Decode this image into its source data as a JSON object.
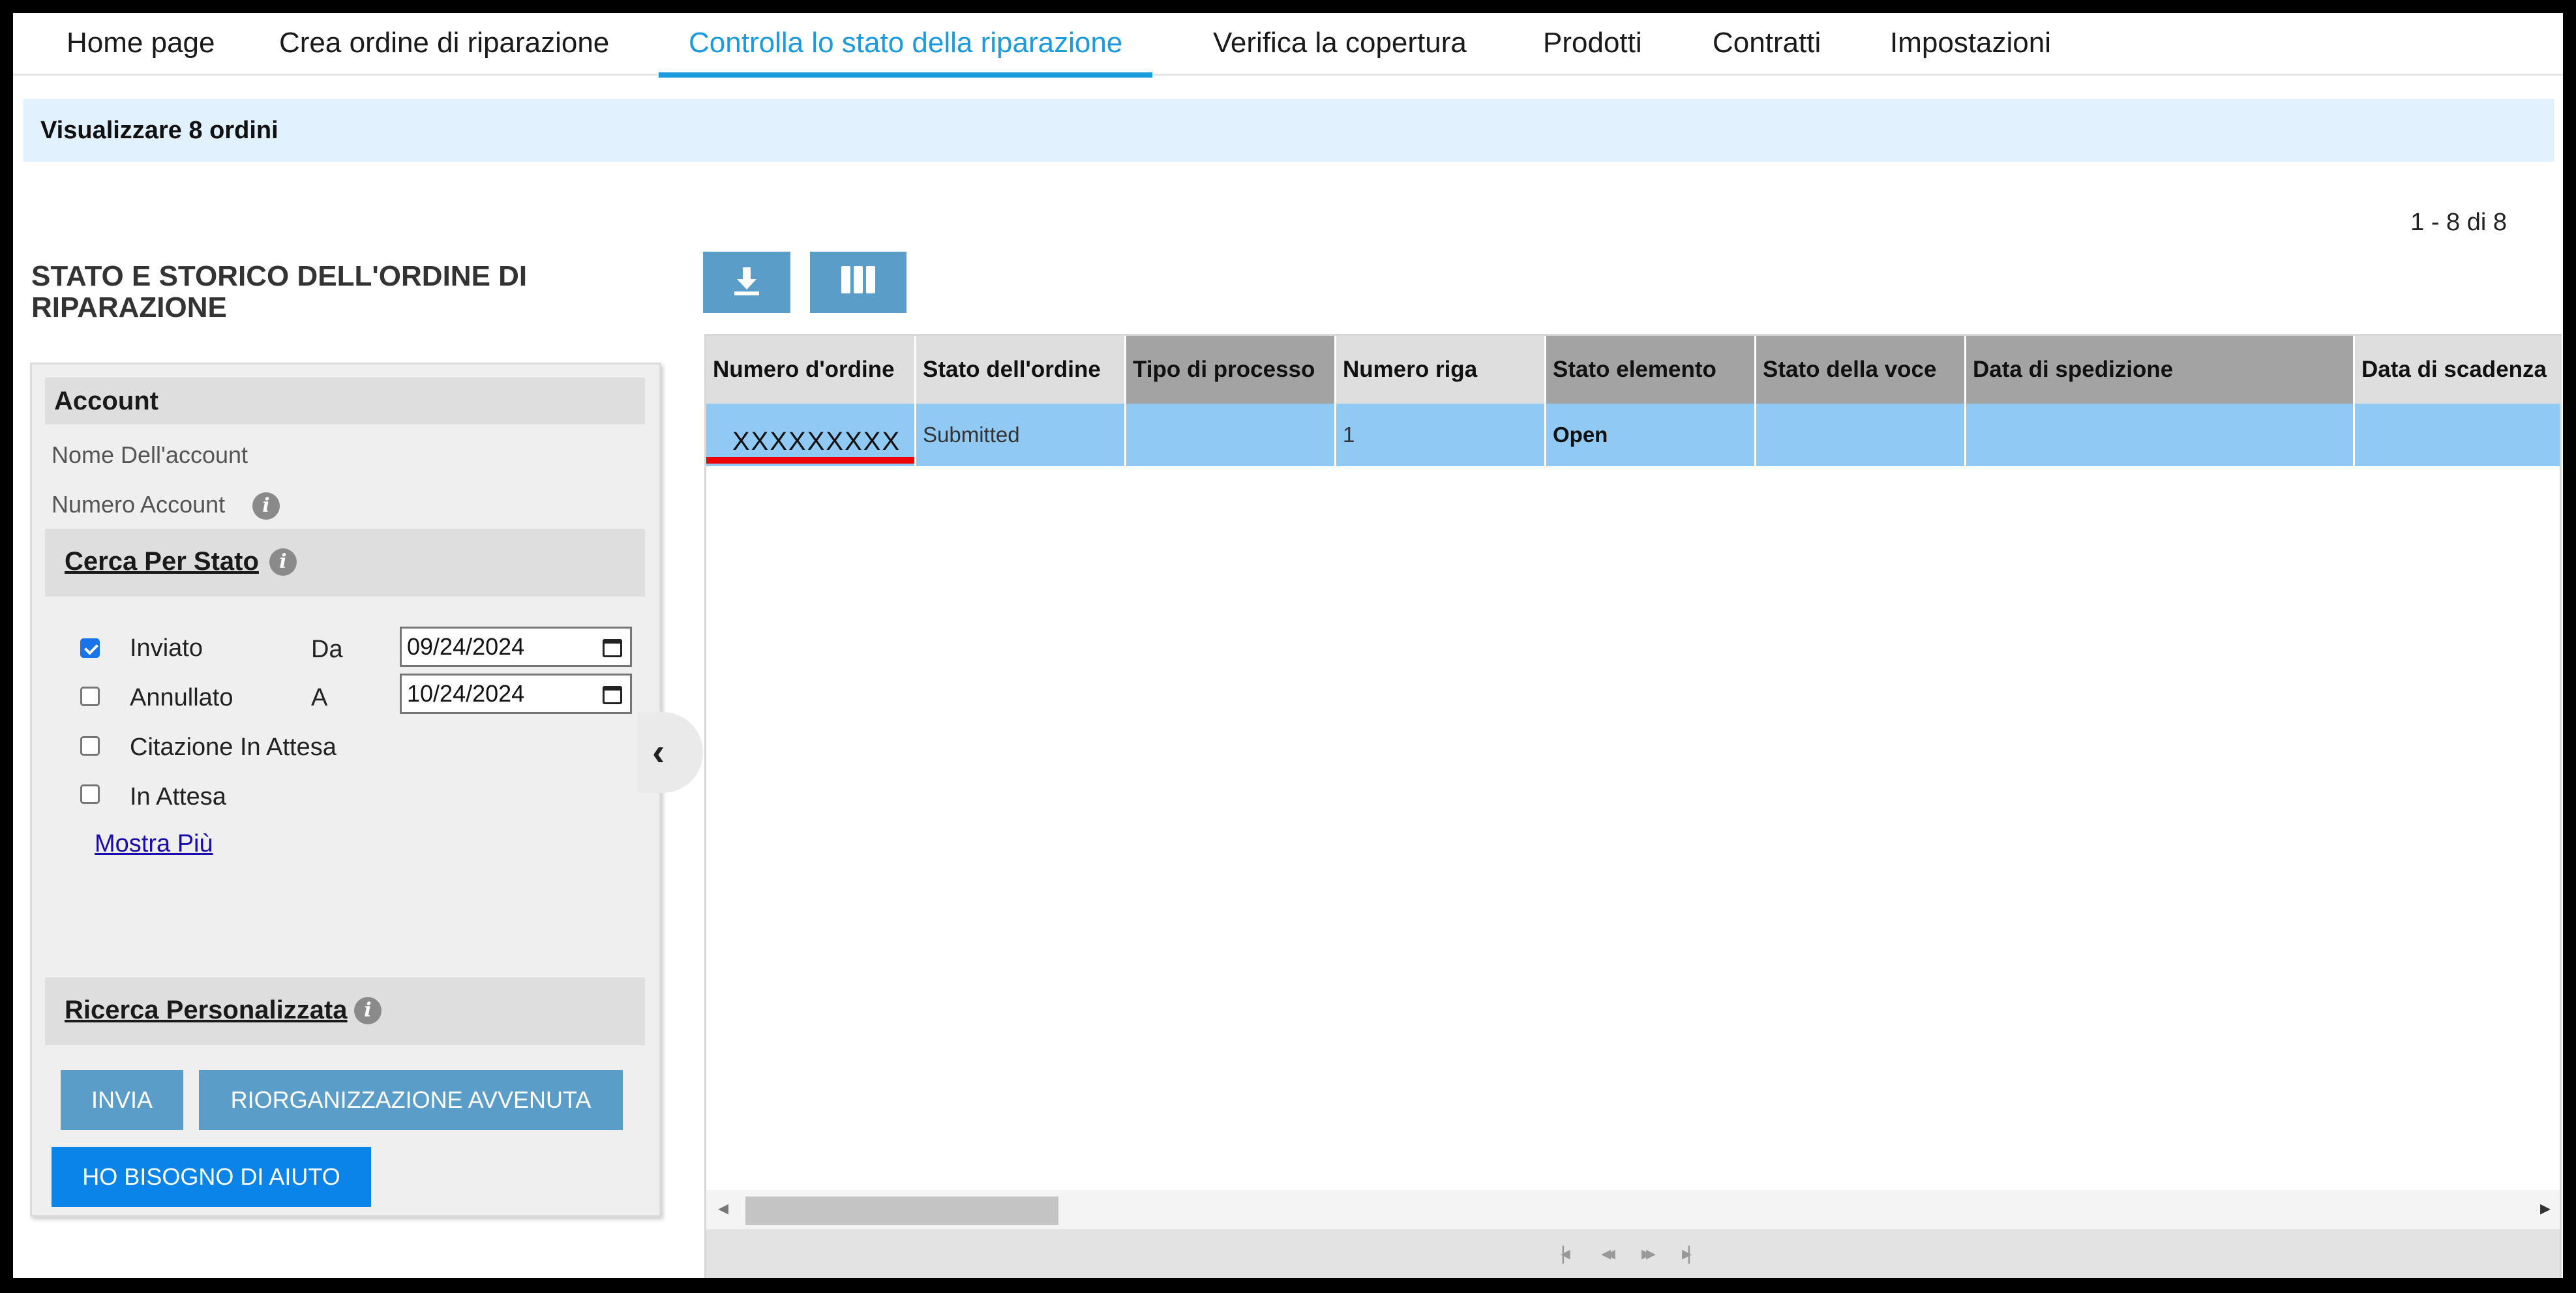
{
  "nav": {
    "items": [
      {
        "label": "Home page",
        "active": false
      },
      {
        "label": "Crea ordine di riparazione",
        "active": false
      },
      {
        "label": "Controlla lo stato della riparazione",
        "active": true
      },
      {
        "label": "Verifica la copertura",
        "active": false
      },
      {
        "label": "Prodotti",
        "active": false
      },
      {
        "label": "Contratti",
        "active": false
      },
      {
        "label": "Impostazioni",
        "active": false
      }
    ]
  },
  "banner": {
    "text": "Visualizzare 8 ordini"
  },
  "pager": {
    "count_text": "1 - 8 di 8"
  },
  "page": {
    "title": "STATO E STORICO DELL'ORDINE DI RIPARAZIONE"
  },
  "filters": {
    "account": {
      "heading": "Account",
      "name_label": "Nome Dell'account",
      "number_label": "Numero Account"
    },
    "status": {
      "heading": "Cerca Per Stato",
      "options": [
        {
          "label": "Inviato",
          "checked": true
        },
        {
          "label": "Annullato",
          "checked": false
        },
        {
          "label": "Citazione In Attesa",
          "checked": false
        },
        {
          "label": "In Attesa",
          "checked": false
        }
      ],
      "from_label": "Da",
      "from_value": "09/24/2024",
      "to_label": "A",
      "to_value": "10/24/2024",
      "show_more": "Mostra Più"
    },
    "custom": {
      "heading": "Ricerca Personalizzata"
    },
    "buttons": {
      "submit": "INVIA",
      "reset": "RIORGANIZZAZIONE AVVENUTA",
      "help": "HO BISOGNO DI AIUTO"
    }
  },
  "toolbar": {
    "download_icon": "download-icon",
    "columns_icon": "columns-icon"
  },
  "grid": {
    "columns": [
      "Numero d'ordine",
      "Stato dell'ordine",
      "Tipo di processo",
      "Numero riga",
      "Stato elemento",
      "Stato della voce",
      "Data di spedizione",
      "Data di scadenza"
    ],
    "rows": [
      {
        "order_number": "XXXXXXXXX",
        "order_status": "Submitted",
        "process_type": "",
        "line_number": "1",
        "item_status": "Open",
        "item_state": "",
        "ship_date": "",
        "due_date": ""
      }
    ]
  },
  "colors": {
    "accent": "#1a9be0",
    "banner_bg": "#e1f1fd",
    "selected_row": "#90c9f4",
    "highlight_box": "#ee0000",
    "button_muted": "#5b9dc9",
    "button_primary": "#0a84e8"
  }
}
